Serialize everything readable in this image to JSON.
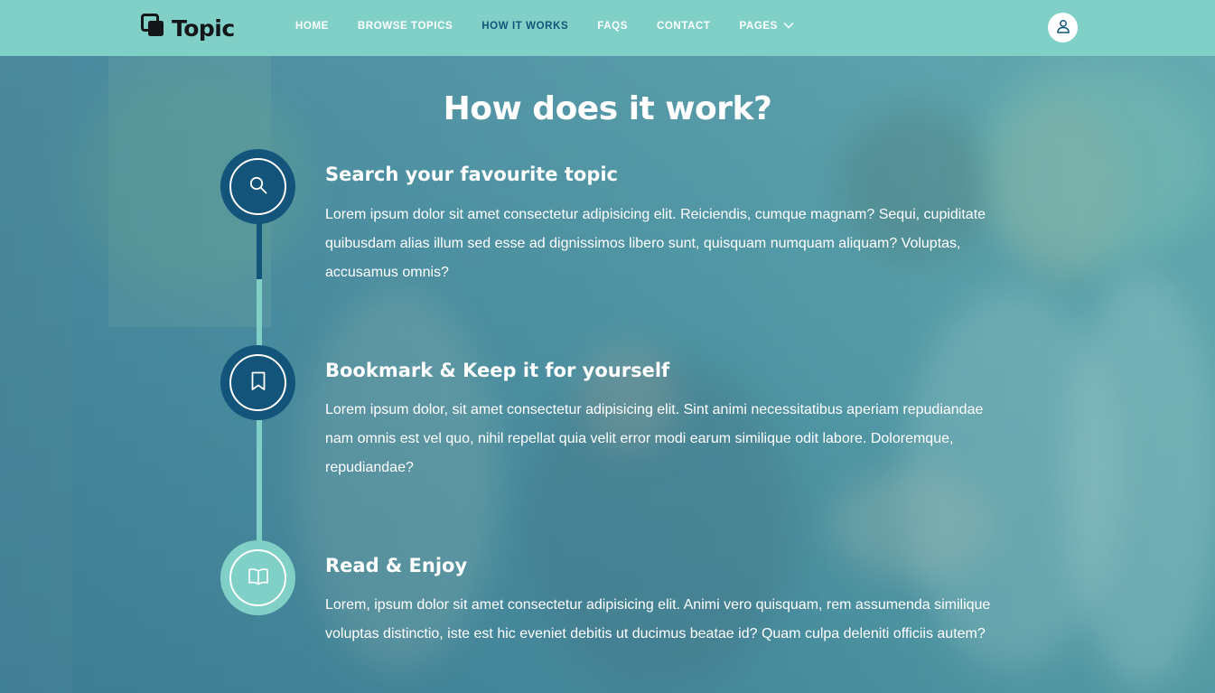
{
  "header": {
    "brand": "Topic",
    "nav": [
      {
        "label": "HOME",
        "active": false
      },
      {
        "label": "BROWSE TOPICS",
        "active": false
      },
      {
        "label": "HOW IT WORKS",
        "active": true
      },
      {
        "label": "FAQS",
        "active": false
      },
      {
        "label": "CONTACT",
        "active": false
      },
      {
        "label": "PAGES",
        "active": false,
        "has_dropdown": true
      }
    ],
    "user_icon": "user-icon"
  },
  "section": {
    "title": "How does it work?",
    "steps": [
      {
        "icon": "search-icon",
        "title": "Search your favourite topic",
        "text": "Lorem ipsum dolor sit amet consectetur adipisicing elit. Reiciendis, cumque magnam? Sequi, cupiditate quibusdam alias illum sed esse ad dignissimos libero sunt, quisquam numquam aliquam? Voluptas, accusamus omnis?"
      },
      {
        "icon": "bookmark-icon",
        "title": "Bookmark & Keep it for yourself",
        "text": "Lorem ipsum dolor, sit amet consectetur adipisicing elit. Sint animi necessitatibus aperiam repudiandae nam omnis est vel quo, nihil repellat quia velit error modi earum similique odit labore. Doloremque, repudiandae?"
      },
      {
        "icon": "book-open-icon",
        "title": "Read & Enjoy",
        "text": "Lorem, ipsum dolor sit amet consectetur adipisicing elit. Animi vero quisquam, rem assumenda similique voluptas distinctio, iste est hic eveniet debitis ut ducimus beatae id? Quam culpa deleniti officiis autem?"
      }
    ]
  },
  "colors": {
    "primary_dark": "#13547a",
    "primary_light": "#80d0c7",
    "white": "#ffffff"
  }
}
